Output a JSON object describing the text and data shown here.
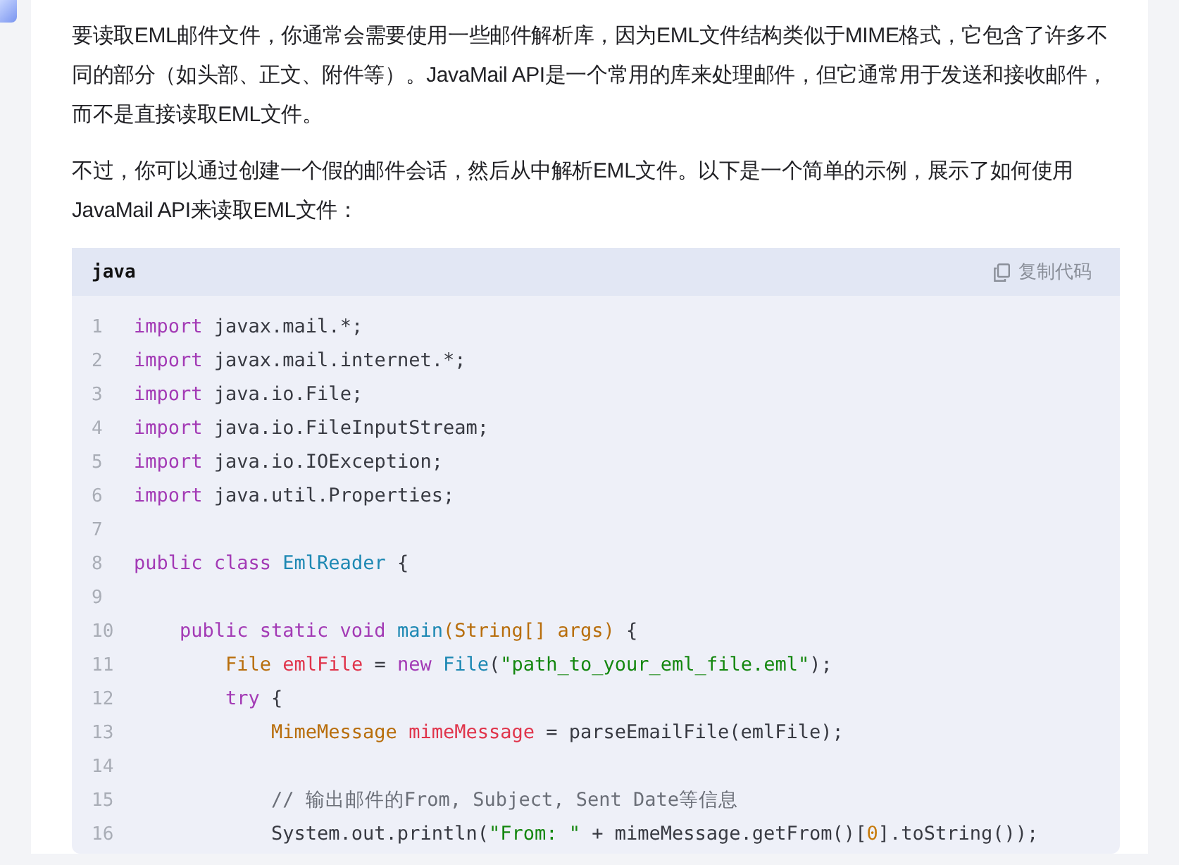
{
  "paragraphs": [
    "要读取EML邮件文件，你通常会需要使用一些邮件解析库，因为EML文件结构类似于MIME格式，它包含了许多不同的部分（如头部、正文、附件等）。JavaMail API是一个常用的库来处理邮件，但它通常用于发送和接收邮件，而不是直接读取EML文件。",
    "不过，你可以通过创建一个假的邮件会话，然后从中解析EML文件。以下是一个简单的示例，展示了如何使用JavaMail API来读取EML文件："
  ],
  "code_block": {
    "language": "java",
    "copy_label": "复制代码",
    "lines": [
      {
        "number": "1",
        "tokens": [
          {
            "kind": "keyword",
            "text": "import"
          },
          {
            "kind": "plain",
            "text": " javax.mail.*;"
          }
        ]
      },
      {
        "number": "2",
        "tokens": [
          {
            "kind": "keyword",
            "text": "import"
          },
          {
            "kind": "plain",
            "text": " javax.mail.internet.*;"
          }
        ]
      },
      {
        "number": "3",
        "tokens": [
          {
            "kind": "keyword",
            "text": "import"
          },
          {
            "kind": "plain",
            "text": " java.io.File;"
          }
        ]
      },
      {
        "number": "4",
        "tokens": [
          {
            "kind": "keyword",
            "text": "import"
          },
          {
            "kind": "plain",
            "text": " java.io.FileInputStream;"
          }
        ]
      },
      {
        "number": "5",
        "tokens": [
          {
            "kind": "keyword",
            "text": "import"
          },
          {
            "kind": "plain",
            "text": " java.io.IOException;"
          }
        ]
      },
      {
        "number": "6",
        "tokens": [
          {
            "kind": "keyword",
            "text": "import"
          },
          {
            "kind": "plain",
            "text": " java.util.Properties;"
          }
        ]
      },
      {
        "number": "7"
      },
      {
        "number": "8",
        "tokens": [
          {
            "kind": "keyword",
            "text": "public class "
          },
          {
            "kind": "function",
            "text": "EmlReader"
          },
          {
            "kind": "plain",
            "text": " {"
          }
        ]
      },
      {
        "number": "9"
      },
      {
        "number": "10",
        "tokens": [
          {
            "kind": "keyword",
            "text": "    public static void "
          },
          {
            "kind": "function",
            "text": "main"
          },
          {
            "kind": "type",
            "text": "(String[] args)"
          },
          {
            "kind": "plain",
            "text": " {"
          }
        ]
      },
      {
        "number": "11",
        "tokens": [
          {
            "kind": "type",
            "text": "        File "
          },
          {
            "kind": "variable",
            "text": "emlFile"
          },
          {
            "kind": "plain",
            "text": " = "
          },
          {
            "kind": "keyword",
            "text": "new "
          },
          {
            "kind": "function",
            "text": "File"
          },
          {
            "kind": "plain",
            "text": "("
          },
          {
            "kind": "string",
            "text": "\"path_to_your_eml_file.eml\""
          },
          {
            "kind": "plain",
            "text": ");"
          }
        ]
      },
      {
        "number": "12",
        "tokens": [
          {
            "kind": "keyword",
            "text": "        try"
          },
          {
            "kind": "plain",
            "text": " {"
          }
        ]
      },
      {
        "number": "13",
        "tokens": [
          {
            "kind": "type",
            "text": "            MimeMessage "
          },
          {
            "kind": "variable",
            "text": "mimeMessage"
          },
          {
            "kind": "plain",
            "text": " = parseEmailFile(emlFile);"
          }
        ]
      },
      {
        "number": "14"
      },
      {
        "number": "15",
        "tokens": [
          {
            "kind": "comment",
            "text": "            // 输出邮件的From, Subject, Sent Date等信息"
          }
        ]
      },
      {
        "number": "16",
        "tokens": [
          {
            "kind": "plain",
            "text": "            System.out.println("
          },
          {
            "kind": "string",
            "text": "\"From: \""
          },
          {
            "kind": "plain",
            "text": " + mimeMessage.getFrom()["
          },
          {
            "kind": "number",
            "text": "0"
          },
          {
            "kind": "plain",
            "text": "].toString());"
          }
        ]
      }
    ]
  }
}
